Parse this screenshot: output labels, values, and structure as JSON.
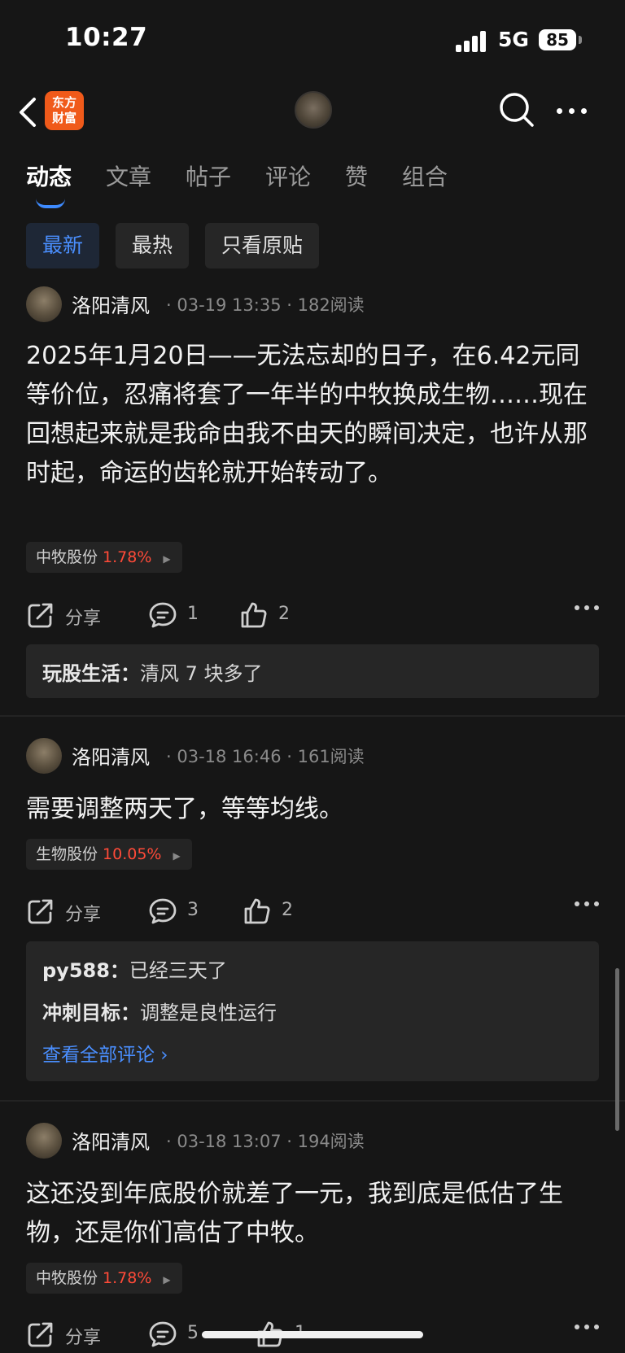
{
  "status_bar": {
    "time": "10:27",
    "network": "5G",
    "battery": "85"
  },
  "nav": {
    "logo_text": "东方\n财富"
  },
  "tabs": [
    {
      "label": "动态"
    },
    {
      "label": "文章"
    },
    {
      "label": "帖子"
    },
    {
      "label": "评论"
    },
    {
      "label": "赞"
    },
    {
      "label": "组合"
    }
  ],
  "filters": [
    {
      "label": "最新"
    },
    {
      "label": "最热"
    },
    {
      "label": "只看原贴"
    }
  ],
  "posts": [
    {
      "author": "洛阳清风",
      "meta": "· 03-19 13:35 · 182阅读",
      "text": "2025年1月20日——无法忘却的日子，在6.42元同等价位，忍痛将套了一年半的中牧换成生物……现在回想起来就是我命由我不由天的瞬间决定，也许从那时起，命运的齿轮就开始转动了。",
      "stock": {
        "name": "中牧股份",
        "change": "1.78%"
      },
      "share_label": "分享",
      "comment_count": "1",
      "like_count": "2",
      "comments": [
        {
          "user": "玩股生活：",
          "text": "清风 7 块多了"
        }
      ]
    },
    {
      "author": "洛阳清风",
      "meta": "· 03-18 16:46 · 161阅读",
      "text": "需要调整两天了，等等均线。",
      "stock": {
        "name": "生物股份",
        "change": "10.05%"
      },
      "share_label": "分享",
      "comment_count": "3",
      "like_count": "2",
      "comments": [
        {
          "user": "py588：",
          "text": "已经三天了"
        },
        {
          "user": "冲刺目标：",
          "text": "调整是良性运行"
        }
      ],
      "view_all": "查看全部评论 ›"
    },
    {
      "author": "洛阳清风",
      "meta": "· 03-18 13:07 · 194阅读",
      "text": "这还没到年底股价就差了一元，我到底是低估了生物，还是你们高估了中牧。",
      "stock": {
        "name": "中牧股份",
        "change": "1.78%"
      },
      "share_label": "分享",
      "comment_count": "5",
      "like_count": "1"
    }
  ]
}
